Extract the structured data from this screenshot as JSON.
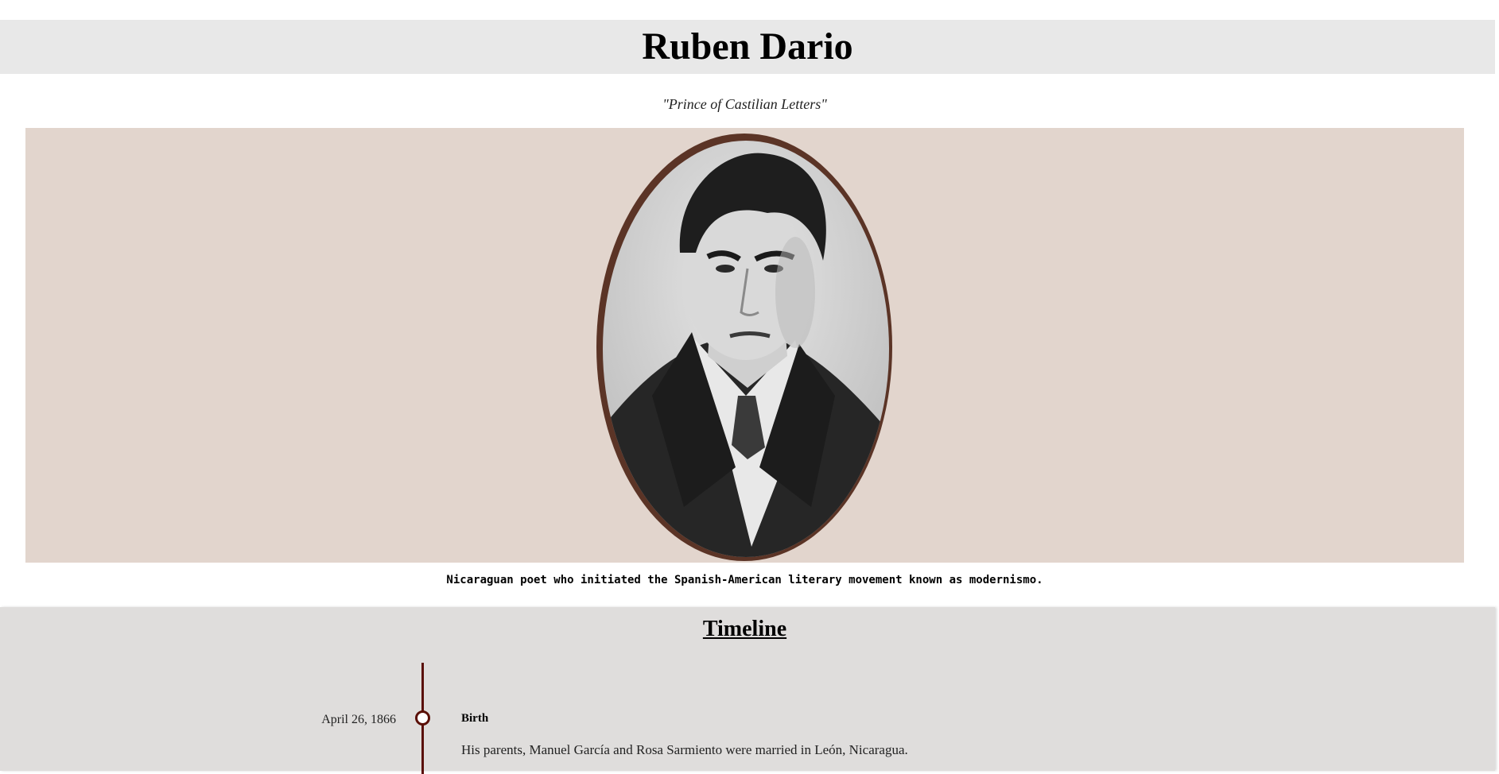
{
  "header": {
    "title": "Ruben Dario"
  },
  "tagline": "\"Prince of Castilian Letters\"",
  "portrait": {
    "frame_color": "#5b3426",
    "panel_color": "#e2d5cd"
  },
  "caption": "Nicaraguan poet who initiated the Spanish-American literary movement known as modernismo.",
  "timeline": {
    "heading": "Timeline",
    "line_color": "#5a0f07",
    "events": [
      {
        "date": "April 26, 1866",
        "title": "Birth",
        "description": "His parents, Manuel García and Rosa Sarmiento were married in León, Nicaragua."
      }
    ]
  }
}
